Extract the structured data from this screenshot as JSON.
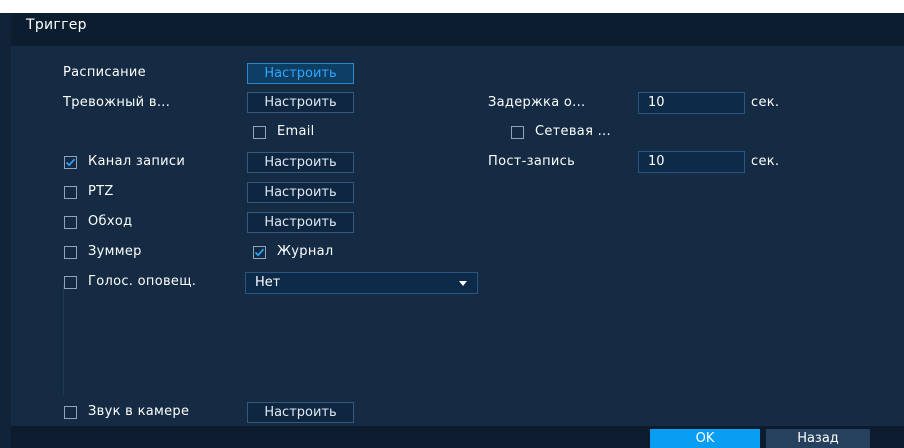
{
  "window": {
    "title": "Триггер"
  },
  "rows": {
    "schedule": {
      "label": "Расписание",
      "button": "Настроить"
    },
    "alarm_out": {
      "label": "Тревожный в...",
      "button": "Настроить",
      "delay_label": "Задержка о...",
      "delay_value": "10",
      "delay_unit": "сек."
    },
    "email": {
      "label": "Email",
      "checked": false
    },
    "network": {
      "label": "Сетевая ...",
      "checked": false
    },
    "record": {
      "label": "Канал записи",
      "checked": true,
      "button": "Настроить",
      "post_label": "Пост-запись",
      "post_value": "10",
      "post_unit": "сек."
    },
    "ptz": {
      "label": "PTZ",
      "checked": false,
      "button": "Настроить"
    },
    "tour": {
      "label": "Обход",
      "checked": false,
      "button": "Настроить"
    },
    "buzzer": {
      "label": "Зуммер",
      "checked": false
    },
    "log": {
      "label": "Журнал",
      "checked": true
    },
    "voice": {
      "label": "Голос. оповещ.",
      "checked": false,
      "select_value": "Нет"
    },
    "camera_audio": {
      "label": "Звук в камере",
      "checked": false,
      "button": "Настроить"
    }
  },
  "footer": {
    "ok": "OK",
    "back": "Назад"
  },
  "colors": {
    "accent": "#0a9ef2",
    "panel": "#142b43",
    "check": "#2fa6ff"
  }
}
